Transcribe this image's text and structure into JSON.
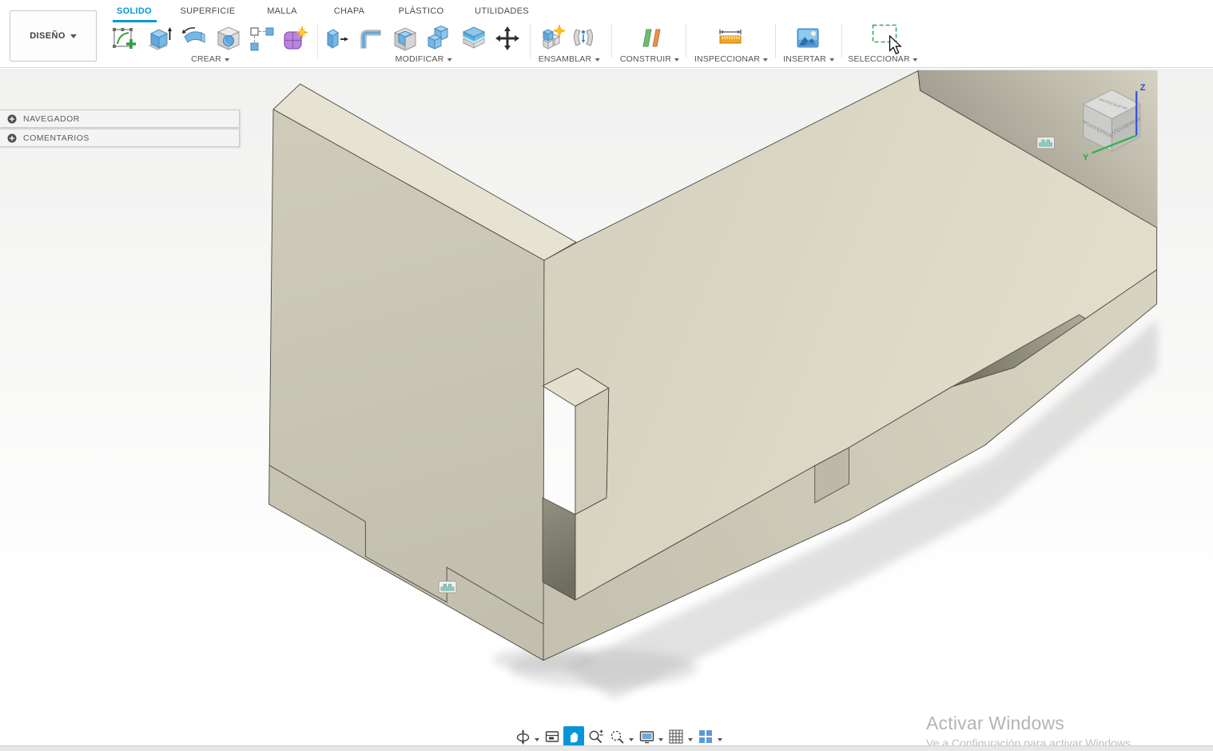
{
  "tabs": [
    {
      "label": "SOLIDO",
      "active": true
    },
    {
      "label": "SUPERFICIE",
      "active": false
    },
    {
      "label": "MALLA",
      "active": false
    },
    {
      "label": "CHAPA",
      "active": false
    },
    {
      "label": "PLÁSTICO",
      "active": false
    },
    {
      "label": "UTILIDADES",
      "active": false
    }
  ],
  "design_menu": {
    "label": "DISEÑO"
  },
  "toolbar_groups": [
    {
      "label": "CREAR",
      "icons": [
        "create-sketch",
        "primitive-box",
        "revolve",
        "hole",
        "rectangular-pattern",
        "create-form"
      ]
    },
    {
      "label": "MODIFICAR",
      "icons": [
        "press-pull",
        "fillet",
        "shell",
        "combine",
        "split-body",
        "move-copy"
      ]
    },
    {
      "label": "ENSAMBLAR",
      "icons": [
        "new-component",
        "joint"
      ]
    },
    {
      "label": "CONSTRUIR",
      "icons": [
        "construction-plane"
      ]
    },
    {
      "label": "INSPECCIONAR",
      "icons": [
        "measure"
      ]
    },
    {
      "label": "INSERTAR",
      "icons": [
        "insert-image"
      ]
    },
    {
      "label": "SELECCIONAR",
      "icons": [
        "select-window"
      ]
    }
  ],
  "browser_panels": [
    {
      "label": "NAVEGADOR"
    },
    {
      "label": "COMENTARIOS"
    }
  ],
  "viewcube": {
    "top": "SUPERIOR",
    "front_left": "POSTERIOR",
    "front_right": "IZQUIERDA",
    "axis_z": "Z",
    "axis_y": "Y"
  },
  "bottom_nav": [
    "orbit",
    "look-at",
    "pan",
    "zoom",
    "fit",
    "display-settings",
    "grid-snap",
    "viewports"
  ],
  "bottom_nav_active": "pan",
  "watermark": {
    "title": "Activar Windows",
    "subtitle": "Ve a Configuración para activar Windows."
  },
  "colors": {
    "accent_blue": "#0696d7",
    "select_green": "#3aa65a",
    "model_top": "#e6e2d1",
    "model_front": "#cac7b5",
    "model_slot_dark": "#7c7a6b",
    "joint_badge_teal": "#8ec6c2"
  }
}
